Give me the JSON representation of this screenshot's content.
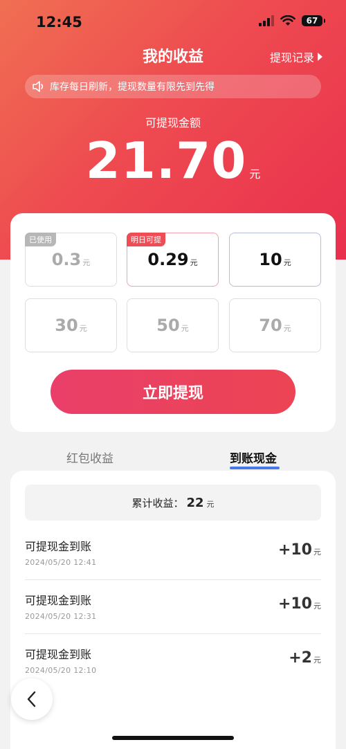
{
  "status_bar": {
    "time": "12:45",
    "battery": "67"
  },
  "header": {
    "title": "我的收益",
    "history_link": "提现记录"
  },
  "notice": {
    "text": "库存每日刷新，提现数量有限先到先得"
  },
  "balance": {
    "label": "可提现金额",
    "value": "21.70",
    "unit": "元"
  },
  "options": [
    {
      "value": "0.3",
      "unit": "元",
      "badge": "已使用",
      "state": "used"
    },
    {
      "value": "0.29",
      "unit": "元",
      "badge": "明日可提",
      "state": "tomorrow"
    },
    {
      "value": "10",
      "unit": "元",
      "badge": "",
      "state": "selected"
    },
    {
      "value": "30",
      "unit": "元",
      "badge": "",
      "state": "disabled"
    },
    {
      "value": "50",
      "unit": "元",
      "badge": "",
      "state": "disabled"
    },
    {
      "value": "70",
      "unit": "元",
      "badge": "",
      "state": "disabled"
    }
  ],
  "withdraw_button": "立即提现",
  "tabs": [
    {
      "label": "红包收益",
      "active": false
    },
    {
      "label": "到账现金",
      "active": true
    }
  ],
  "summary": {
    "label": "累计收益：",
    "value": "22",
    "unit": "元"
  },
  "records": [
    {
      "title": "可提现金到账",
      "time": "2024/05/20 12:41",
      "amount": "+10",
      "unit": "元"
    },
    {
      "title": "可提现金到账",
      "time": "2024/05/20 12:31",
      "amount": "+10",
      "unit": "元"
    },
    {
      "title": "可提现金到账",
      "time": "2024/05/20 12:10",
      "amount": "+2",
      "unit": "元"
    }
  ],
  "icons": {
    "speaker": "speaker-icon",
    "back": "chevron-left-icon",
    "signal": "signal-icon",
    "wifi": "wifi-icon",
    "battery": "battery-icon"
  },
  "colors": {
    "accent": "#ee4a50",
    "tab_underline": "#4a77e8"
  }
}
